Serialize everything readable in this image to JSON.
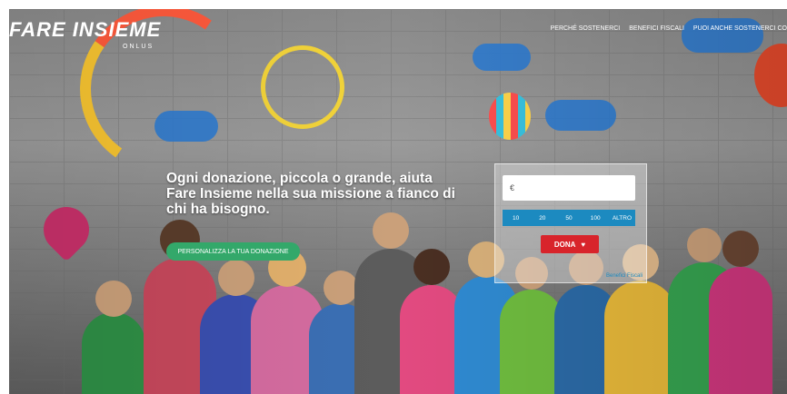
{
  "brand": {
    "name": "FARE INSIEME",
    "sub": "ONLUS"
  },
  "nav": {
    "items": [
      "PERCHÉ SOSTENERCI",
      "BENEFICI FISCALI",
      "PUOI ANCHE SOSTENERCI CO"
    ]
  },
  "hero": {
    "headline": "Ogni donazione, piccola o grande, aiuta Fare Insieme nella sua missione a fianco di chi ha bisogno.",
    "cta_label": "PERSONALIZZA LA TUA DONAZIONE"
  },
  "donation": {
    "currency_symbol": "€",
    "amount_value": "",
    "amount_placeholder": "",
    "presets": [
      "10",
      "20",
      "50",
      "100",
      "ALTRO"
    ],
    "donate_label": "DONA",
    "benefits_link": "Benefici Fiscali",
    "colors": {
      "preset_bg": "#1c8ac0",
      "donate_bg": "#d8242b",
      "cta_bg": "#33a86a"
    },
    "icons": {
      "donate_icon": "heart-icon"
    }
  }
}
